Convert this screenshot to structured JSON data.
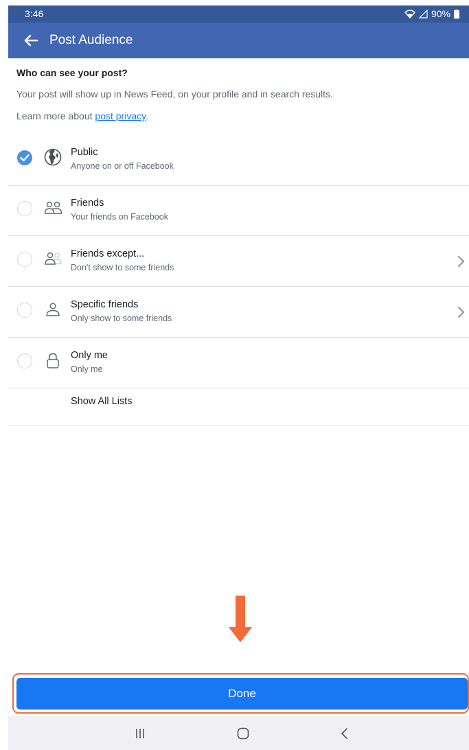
{
  "status_bar": {
    "time": "3:46",
    "battery": "90%"
  },
  "app_bar": {
    "title": "Post Audience"
  },
  "intro": {
    "title": "Who can see your post?",
    "text": "Your post will show up in News Feed, on your profile and in search results.",
    "learn_more_prefix": "Learn more about ",
    "learn_more_link": "post privacy",
    "learn_more_suffix": "."
  },
  "options": [
    {
      "label": "Public",
      "sublabel": "Anyone on or off Facebook",
      "icon": "globe-icon",
      "selected": true
    },
    {
      "label": "Friends",
      "sublabel": "Your friends on Facebook",
      "icon": "friends-icon",
      "selected": false
    },
    {
      "label": "Friends except...",
      "sublabel": "Don't show to some friends",
      "icon": "friends-except-icon",
      "selected": false,
      "has_chevron": true
    },
    {
      "label": "Specific friends",
      "sublabel": "Only show to some friends",
      "icon": "person-icon",
      "selected": false,
      "has_chevron": true
    },
    {
      "label": "Only me",
      "sublabel": "Only me",
      "icon": "lock-icon",
      "selected": false
    }
  ],
  "show_all_lists": "Show All Lists",
  "done_button": "Done",
  "colors": {
    "header": "#4267b2",
    "status_bar": "#355998",
    "primary": "#1877f2",
    "annotation": "#f26b3a",
    "selected_radio": "#4a90e2"
  },
  "nav": {
    "recents": "recents-icon",
    "home": "home-icon",
    "back": "back-nav-icon"
  }
}
